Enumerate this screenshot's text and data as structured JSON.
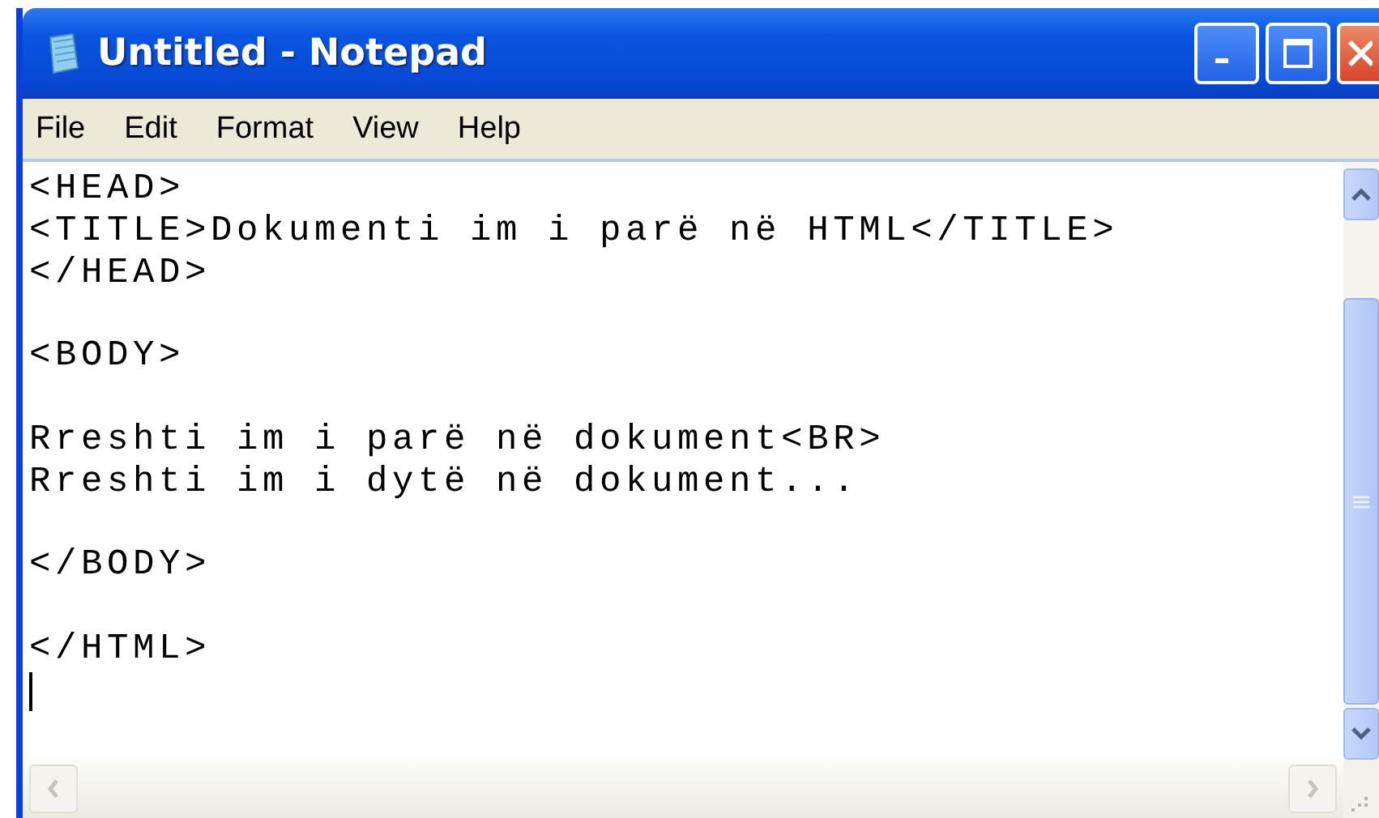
{
  "window": {
    "title": "Untitled - Notepad"
  },
  "menu": [
    "File",
    "Edit",
    "Format",
    "View",
    "Help"
  ],
  "editor": {
    "text": "<HEAD>\n<TITLE>Dokumenti im i parë në HTML</TITLE>\n</HEAD>\n\n<BODY>\n\nRreshti im i parë në dokument<BR>\nRreshti im i dytë në dokument...\n\n</BODY>\n\n</HTML>"
  }
}
